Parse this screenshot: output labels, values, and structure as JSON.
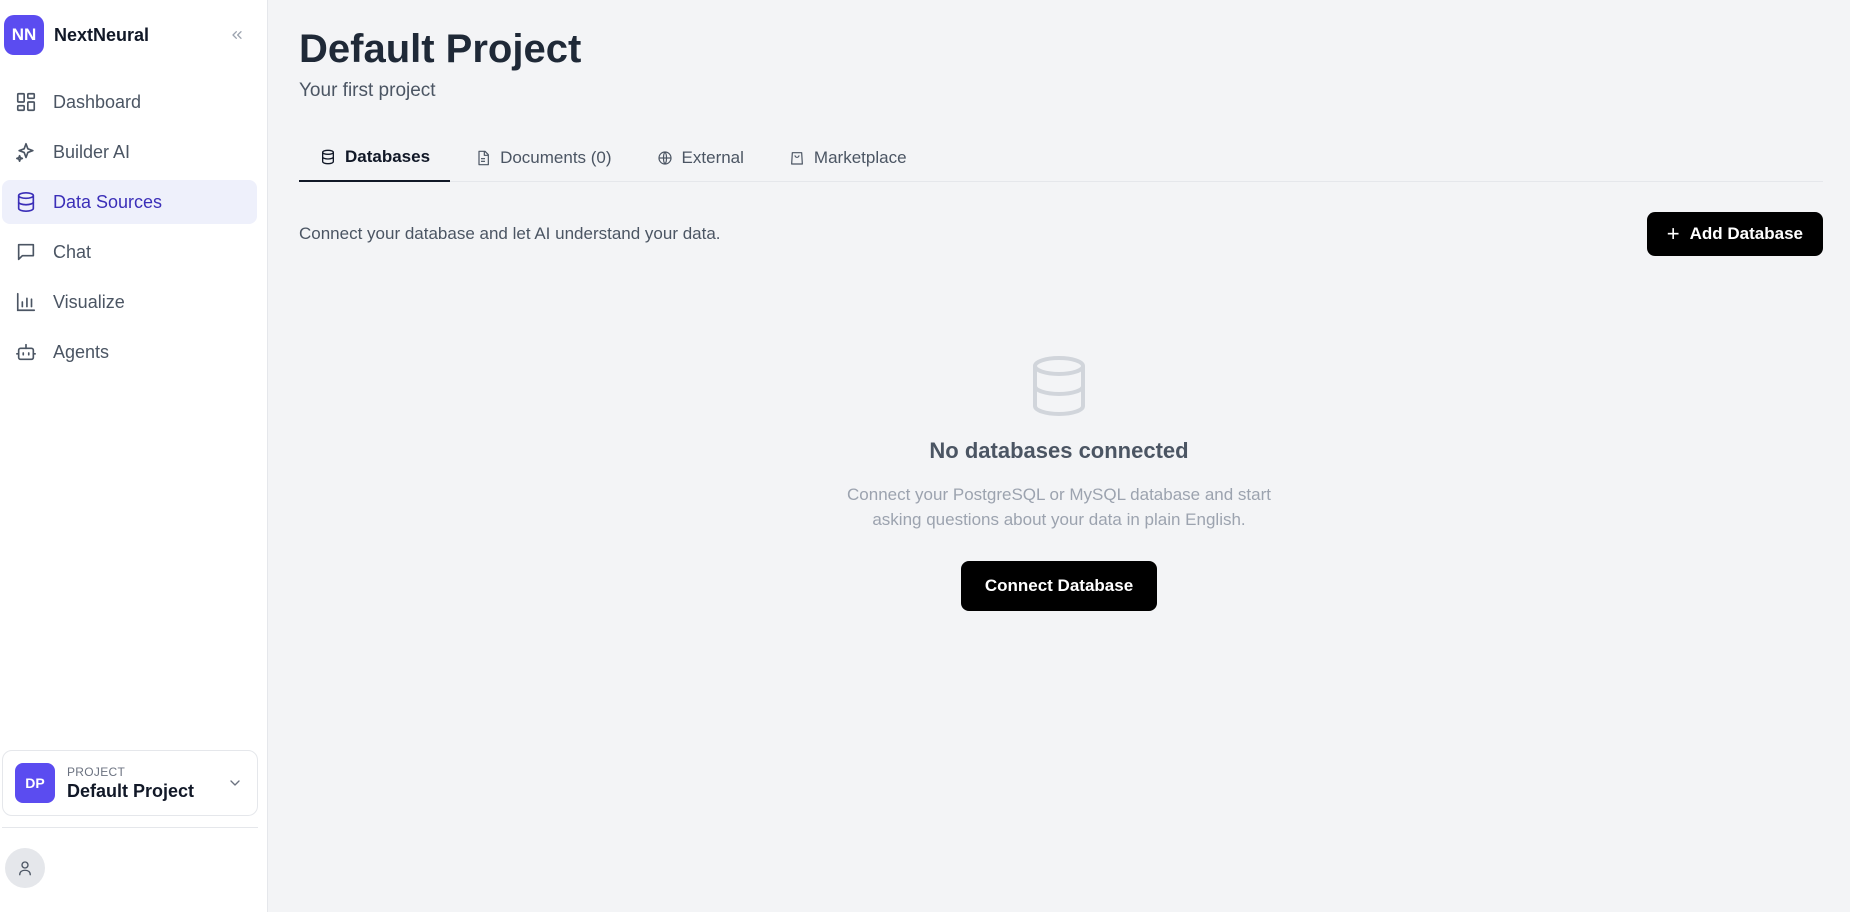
{
  "brand": {
    "logo_text": "NN",
    "name": "NextNeural"
  },
  "sidebar": {
    "items": [
      {
        "label": "Dashboard",
        "icon": "dashboard-icon",
        "active": false
      },
      {
        "label": "Builder AI",
        "icon": "sparkles-icon",
        "active": false
      },
      {
        "label": "Data Sources",
        "icon": "database-icon",
        "active": true
      },
      {
        "label": "Chat",
        "icon": "chat-icon",
        "active": false
      },
      {
        "label": "Visualize",
        "icon": "bar-chart-icon",
        "active": false
      },
      {
        "label": "Agents",
        "icon": "bot-icon",
        "active": false
      }
    ],
    "project": {
      "avatar_text": "DP",
      "eyebrow": "PROJECT",
      "name": "Default Project"
    }
  },
  "main": {
    "title": "Default Project",
    "subtitle": "Your first project",
    "tabs": [
      {
        "label": "Databases",
        "icon": "database-icon",
        "active": true
      },
      {
        "label": "Documents (0)",
        "icon": "document-icon",
        "active": false
      },
      {
        "label": "External",
        "icon": "globe-icon",
        "active": false
      },
      {
        "label": "Marketplace",
        "icon": "shopping-bag-icon",
        "active": false
      }
    ],
    "toolbar": {
      "description": "Connect your database and let AI understand your data.",
      "add_button_label": "Add Database"
    },
    "empty_state": {
      "title": "No databases connected",
      "description_line1": "Connect your PostgreSQL or MySQL database and start",
      "description_line2": "asking questions about your data in plain English.",
      "button_label": "Connect Database"
    }
  },
  "colors": {
    "accent": "#5b4cf0",
    "active_nav_bg": "#eef0fb",
    "active_nav_text": "#3b2fb8",
    "page_bg": "#f3f4f6"
  }
}
